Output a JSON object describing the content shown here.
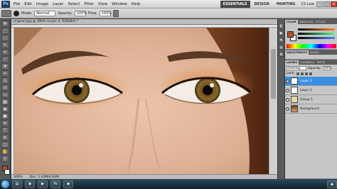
{
  "menubar": {
    "logo": "Ps",
    "items": [
      "File",
      "Edit",
      "Image",
      "Layer",
      "Select",
      "Filter",
      "View",
      "Window",
      "Help"
    ],
    "workspaces": [
      "ESSENTIALS",
      "DESIGN",
      "PAINTING"
    ],
    "cs_live": "CS Live"
  },
  "options": {
    "mode_label": "Mode:",
    "mode_value": "Normal",
    "opacity_label": "Opacity:",
    "opacity_value": "100%",
    "flow_label": "Flow:",
    "flow_value": "100%"
  },
  "document": {
    "tab_title": "original.jpg @ 300% (Layer 2, RGB/8#) *",
    "zoom": "300%",
    "doc_info": "Doc: 1.03M/4.83M"
  },
  "panels": {
    "color_tabs": [
      "COLOR",
      "SWATCHES",
      "STYLES"
    ],
    "adj_tabs": [
      "ADJUSTMENTS",
      "MASKS"
    ],
    "layer_tabs": [
      "LAYERS",
      "CHANNELS",
      "PATHS"
    ],
    "blend_mode": "Overlay",
    "opacity_label": "Opacity:",
    "opacity_value": "50%",
    "lock_label": "Lock:",
    "layers": [
      {
        "name": "Layer 2",
        "selected": true
      },
      {
        "name": "Layer 1",
        "selected": false
      },
      {
        "name": "Group 1",
        "selected": false
      },
      {
        "name": "Background",
        "selected": false
      }
    ]
  },
  "colors": {
    "foreground": "#b5532a",
    "background": "#f2f2f2",
    "selection": "#3b8fe2"
  }
}
